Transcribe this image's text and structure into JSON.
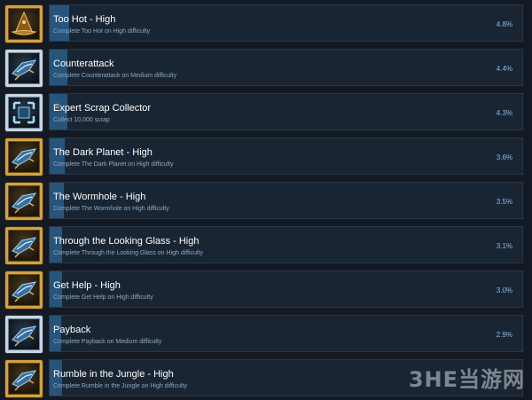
{
  "achievements": [
    {
      "title": "Too Hot - High",
      "description": "Complete Too Hot on High difficulty",
      "percent_label": "4.8%",
      "percent": 4.8,
      "icon": "wizard-hat-icon",
      "frame": "gold"
    },
    {
      "title": "Counterattack",
      "description": "Complete Counterattack on Medium difficulty",
      "percent_label": "4.4%",
      "percent": 4.4,
      "icon": "spaceship-icon",
      "frame": "silver"
    },
    {
      "title": "Expert Scrap Collector",
      "description": "Collect 10,000 scrap",
      "percent_label": "4.3%",
      "percent": 4.3,
      "icon": "scrap-target-icon",
      "frame": "silver"
    },
    {
      "title": "The Dark Planet - High",
      "description": "Complete The Dark Planet on High difficulty",
      "percent_label": "3.6%",
      "percent": 3.6,
      "icon": "spaceship-icon",
      "frame": "gold"
    },
    {
      "title": "The Wormhole - High",
      "description": "Complete The Wormhole on High difficulty",
      "percent_label": "3.5%",
      "percent": 3.5,
      "icon": "spaceship-icon",
      "frame": "gold"
    },
    {
      "title": "Through the Looking Glass - High",
      "description": "Complete Through the Looking Glass on High difficulty",
      "percent_label": "3.1%",
      "percent": 3.1,
      "icon": "spaceship-icon",
      "frame": "gold"
    },
    {
      "title": "Get Help - High",
      "description": "Complete Get Help on High difficulty",
      "percent_label": "3.0%",
      "percent": 3.0,
      "icon": "spaceship-icon",
      "frame": "gold"
    },
    {
      "title": "Payback",
      "description": "Complete Payback on Medium difficulty",
      "percent_label": "2.9%",
      "percent": 2.9,
      "icon": "spaceship-icon",
      "frame": "silver"
    },
    {
      "title": "Rumble in the Jungle - High",
      "description": "Complete Rumble in the Jungle on High difficulty",
      "percent_label": "",
      "percent": null,
      "icon": "spaceship-icon",
      "frame": "gold"
    }
  ],
  "watermark": "3HE当游网",
  "colors": {
    "background": "#141a23",
    "panel": "#1a2534",
    "progress_fill": "#27547a",
    "title_text": "#ffffff",
    "description_text": "#8fa8be",
    "percent_text": "#8bbbe4",
    "gold_frame": "#d1a142",
    "silver_frame": "#c8d6e4"
  }
}
